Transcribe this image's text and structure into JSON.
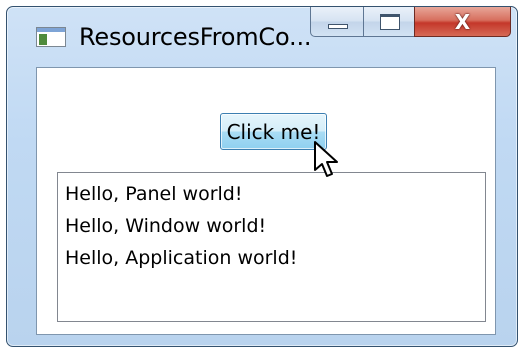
{
  "window": {
    "title": "ResourcesFromCo...",
    "close_glyph": "X"
  },
  "main": {
    "button_label": "Click me!",
    "list_items": [
      "Hello, Panel world!",
      "Hello, Window world!",
      "Hello, Application world!"
    ]
  },
  "icons": {
    "app": "application-window-icon",
    "minimize": "minimize-icon",
    "maximize": "maximize-icon",
    "close": "close-icon",
    "cursor": "mouse-pointer-icon"
  },
  "colors": {
    "window_frame": "#b9d3ee",
    "close_button": "#c4372a",
    "button_hover": "#8fd0f0"
  }
}
